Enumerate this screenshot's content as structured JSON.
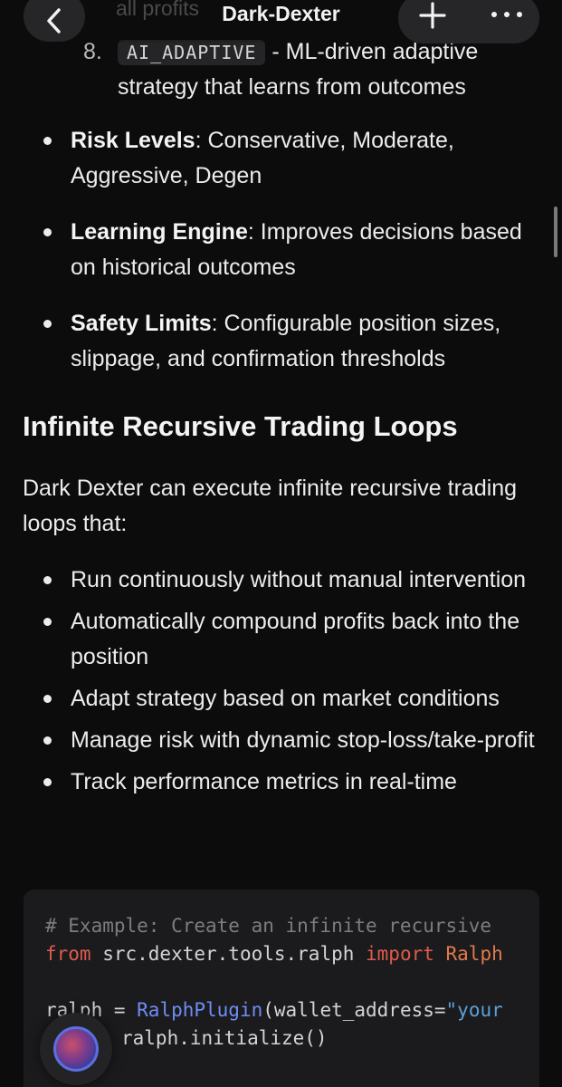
{
  "nav": {
    "title": "Dark-Dexter",
    "ghost_text": "all profits"
  },
  "ordered_item": {
    "number": "8.",
    "code": "AI_ADAPTIVE",
    "text_after_code": " - ML-driven adaptive strategy that learns from outcomes"
  },
  "features": [
    {
      "label": "Risk Levels",
      "text": ": Conservative, Moderate, Aggressive, Degen"
    },
    {
      "label": "Learning Engine",
      "text": ": Improves decisions based on historical outcomes"
    },
    {
      "label": "Safety Limits",
      "text": ": Configurable position sizes, slippage, and confirmation thresholds"
    }
  ],
  "section": {
    "heading": "Infinite Recursive Trading Loops",
    "intro": "Dark Dexter can execute infinite recursive trading loops that:"
  },
  "loop_items": [
    "Run continuously without manual intervention",
    "Automatically compound profits back into the position",
    "Adapt strategy based on market conditions",
    "Manage risk with dynamic stop-loss/take-profit",
    "Track performance metrics in real-time"
  ],
  "code": {
    "line1": "# Example: Create an infinite recursive",
    "line2_kw1": "from",
    "line2_mod": " src.dexter.tools.ralph ",
    "line2_kw2": "import",
    "line2_cls": " Ralph",
    "line4_var": "ralph = ",
    "line4_fn": "RalphPlugin",
    "line4_rest": "(wallet_address=",
    "line4_str": "\"your",
    "line5": "ralph.initialize()"
  },
  "icons": {
    "back": "chevron-left-icon",
    "plus": "plus-icon",
    "more": "more-horizontal-icon"
  },
  "colors": {
    "background": "#0c0c0d",
    "keyword": "#e05a4e",
    "class": "#e3794b",
    "function": "#6f8df5",
    "string": "#5aa0d8",
    "comment": "#7d7d80"
  }
}
